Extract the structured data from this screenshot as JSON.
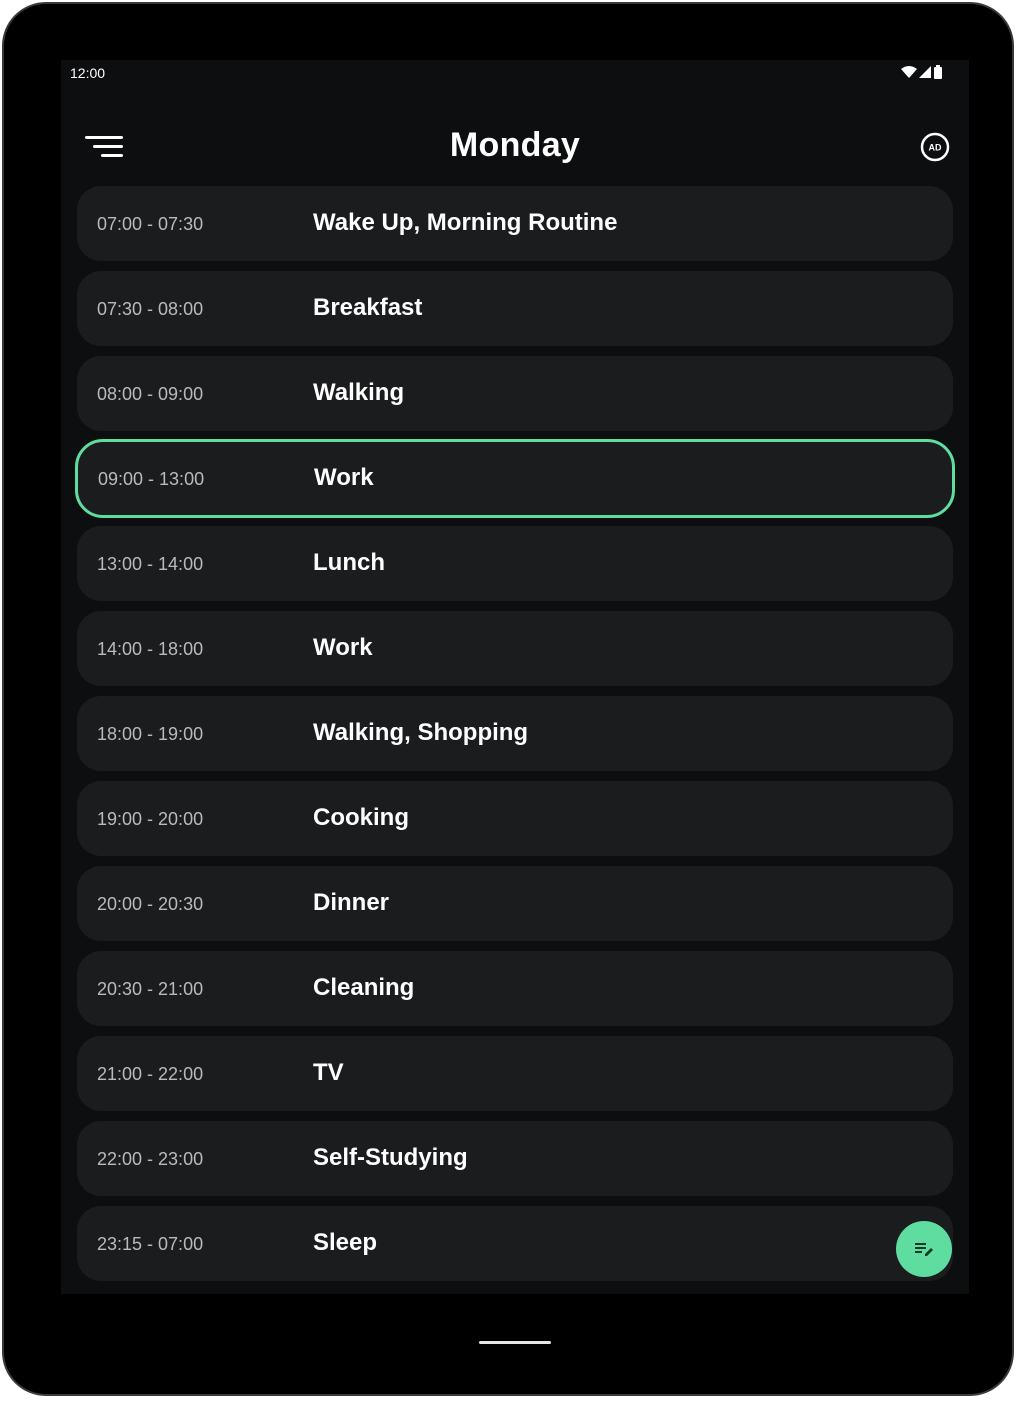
{
  "status_bar": {
    "time": "12:00",
    "icons": [
      "wifi-icon",
      "signal-icon",
      "battery-icon"
    ]
  },
  "app_bar": {
    "title": "Monday",
    "menu_icon": "hamburger-menu-icon",
    "ad_icon": "ad-badge-icon",
    "ad_label": "AD"
  },
  "schedule": [
    {
      "time": "07:00 - 07:30",
      "title": "Wake Up, Morning Routine",
      "active": false
    },
    {
      "time": "07:30 - 08:00",
      "title": "Breakfast",
      "active": false
    },
    {
      "time": "08:00 - 09:00",
      "title": "Walking",
      "active": false
    },
    {
      "time": "09:00 - 13:00",
      "title": "Work",
      "active": true
    },
    {
      "time": "13:00 - 14:00",
      "title": "Lunch",
      "active": false
    },
    {
      "time": "14:00 - 18:00",
      "title": "Work",
      "active": false
    },
    {
      "time": "18:00 - 19:00",
      "title": "Walking, Shopping",
      "active": false
    },
    {
      "time": "19:00 - 20:00",
      "title": "Cooking",
      "active": false
    },
    {
      "time": "20:00 - 20:30",
      "title": "Dinner",
      "active": false
    },
    {
      "time": "20:30 - 21:00",
      "title": "Cleaning",
      "active": false
    },
    {
      "time": "21:00 - 22:00",
      "title": "TV",
      "active": false
    },
    {
      "time": "22:00 - 23:00",
      "title": "Self-Studying",
      "active": false
    },
    {
      "time": "23:15 - 07:00",
      "title": "Sleep",
      "active": false
    }
  ],
  "fab": {
    "icon": "edit-list-icon"
  },
  "colors": {
    "accent": "#5fdca0",
    "background": "#0d0e0f",
    "card": "#1b1c1e",
    "time_text": "#b8babd",
    "title_text": "#ffffff"
  }
}
